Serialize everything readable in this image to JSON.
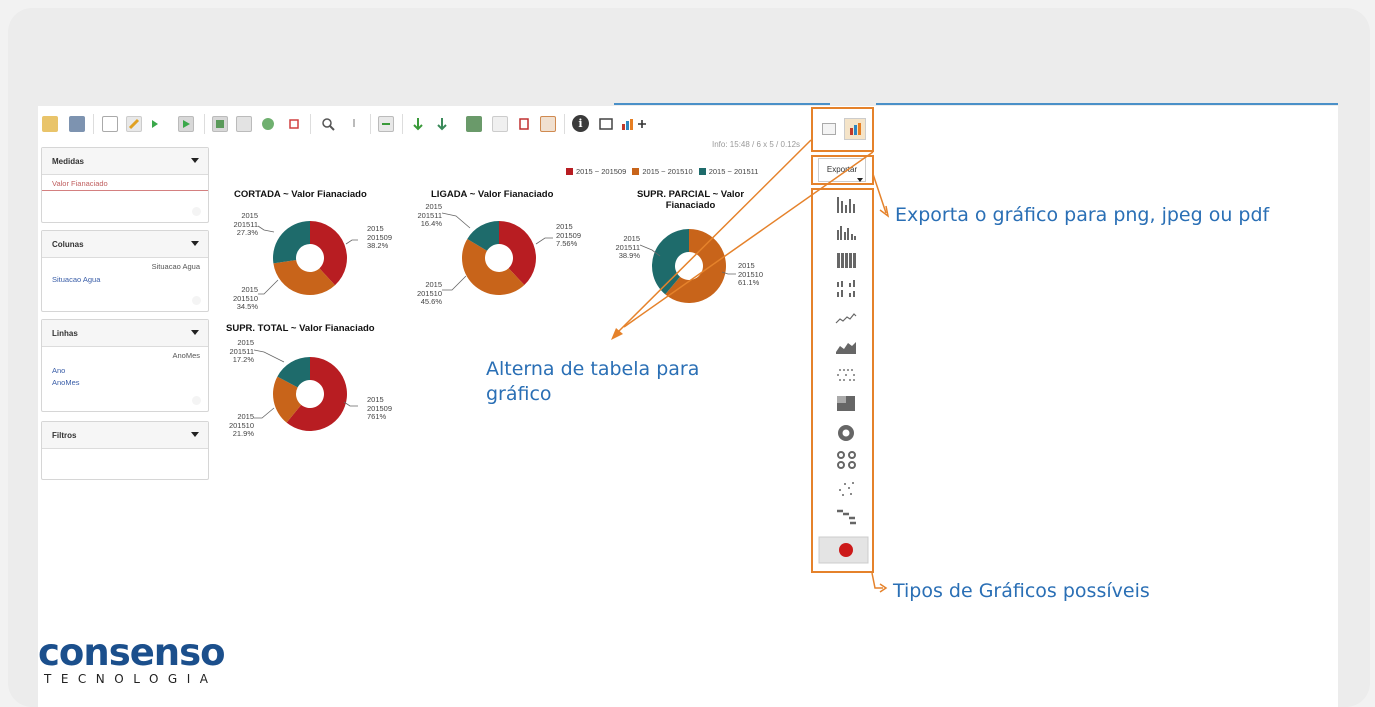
{
  "panels": {
    "medidas": {
      "title": "Medidas",
      "item": "Valor Fianaciado"
    },
    "colunas": {
      "title": "Colunas",
      "right": "Situacao Agua",
      "item": "Situacao Agua"
    },
    "linhas": {
      "title": "Linhas",
      "right": "AnoMes",
      "items": [
        "Ano",
        "AnoMes"
      ]
    },
    "filtros": {
      "title": "Filtros"
    }
  },
  "info": "Info: 15:48  / 6 x 5  / 0.12s",
  "export_label": "Exportar",
  "legend": [
    {
      "label": "2015 ~ 201509",
      "color": "#b81d22"
    },
    {
      "label": "2015 ~ 201510",
      "color": "#c8641a"
    },
    {
      "label": "2015 ~ 201511",
      "color": "#1e6b6b"
    }
  ],
  "charts": {
    "cortada": {
      "title": "CORTADA ~ Valor Fianaciado",
      "l1": "2015",
      "l2": "201511",
      "l3": "27.3%",
      "r1": "2015",
      "r2": "201509",
      "r3": "38.2%",
      "b1": "2015",
      "b2": "201510",
      "b3": "34.5%"
    },
    "ligada": {
      "title": "LIGADA ~ Valor Fianaciado",
      "l1": "2015",
      "l2": "201511",
      "l3": "16.4%",
      "r1": "2015",
      "r2": "201509",
      "r3": "7.56%",
      "b1": "2015",
      "b2": "201510",
      "b3": "45.6%"
    },
    "parcial": {
      "title1": "SUPR. PARCIAL ~ Valor",
      "title2": "Fianaciado",
      "l1": "2015",
      "l2": "201511",
      "l3": "38.9%",
      "r1": "2015",
      "r2": "201510",
      "r3": "61.1%"
    },
    "total": {
      "title": "SUPR. TOTAL ~ Valor Fianaciado",
      "l1": "2015",
      "l2": "201511",
      "l3": "17.2%",
      "r1": "2015",
      "r2": "201509",
      "r3": "761%",
      "b1": "2015",
      "b2": "201510",
      "b3": "21.9%"
    }
  },
  "chart_data": [
    {
      "type": "pie",
      "title": "CORTADA ~ Valor Fianaciado",
      "categories": [
        "2015 ~ 201509",
        "2015 ~ 201510",
        "2015 ~ 201511"
      ],
      "values": [
        38.2,
        34.5,
        27.3
      ]
    },
    {
      "type": "pie",
      "title": "LIGADA ~ Valor Fianaciado",
      "categories": [
        "2015 ~ 201509",
        "2015 ~ 201510",
        "2015 ~ 201511"
      ],
      "values": [
        38.0,
        45.6,
        16.4
      ]
    },
    {
      "type": "pie",
      "title": "SUPR. PARCIAL ~ Valor Fianaciado",
      "categories": [
        "2015 ~ 201510",
        "2015 ~ 201511"
      ],
      "values": [
        61.1,
        38.9
      ]
    },
    {
      "type": "pie",
      "title": "SUPR. TOTAL ~ Valor Fianaciado",
      "categories": [
        "2015 ~ 201509",
        "2015 ~ 201510",
        "2015 ~ 201511"
      ],
      "values": [
        60.9,
        21.9,
        17.2
      ]
    }
  ],
  "annotations": {
    "exporta": "Exporta o gráfico para  png, jpeg ou pdf",
    "alterna1": "Alterna de tabela para",
    "alterna2": "gráfico",
    "tipos": "Tipos de Gráficos possíveis"
  },
  "logo": {
    "name": "consenso",
    "sub": "TECNOLOGIA",
    "color": "#1b4f8c"
  },
  "colors": {
    "accent": "#e5822b",
    "annotation": "#2a6fb5"
  }
}
